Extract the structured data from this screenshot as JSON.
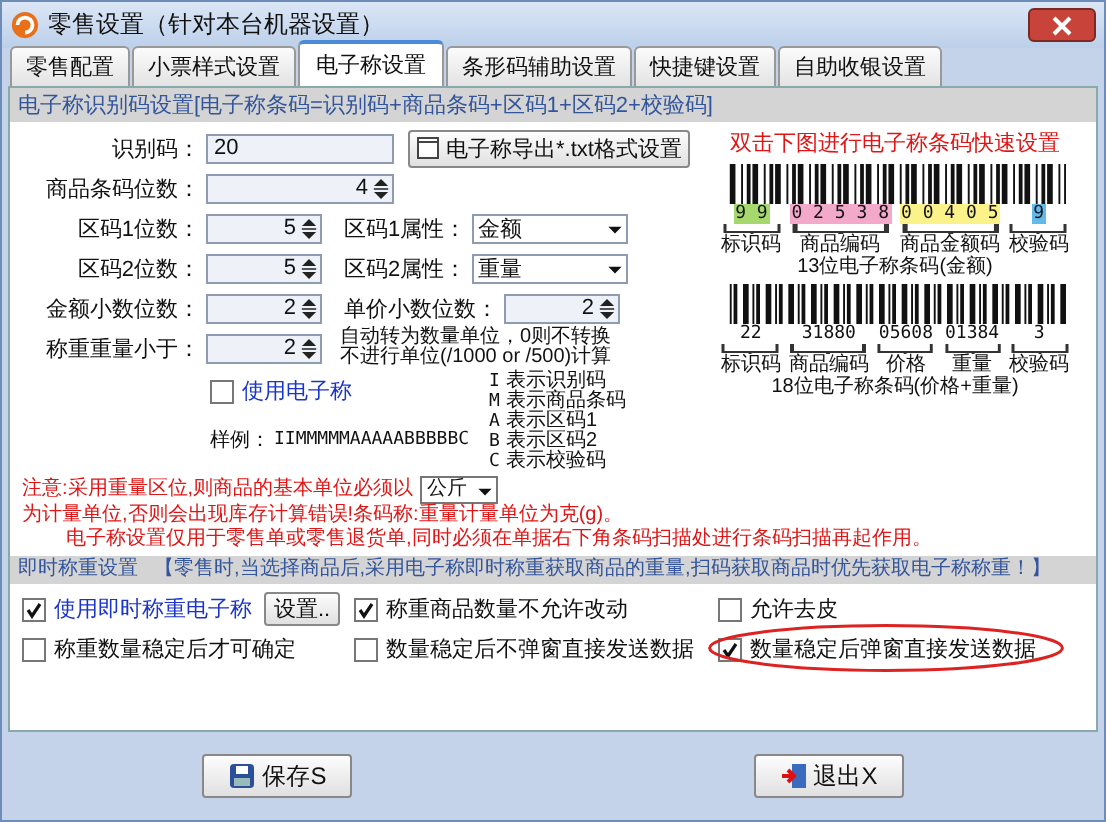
{
  "window": {
    "title": "零售设置（针对本台机器设置）"
  },
  "tabs": [
    {
      "label": "零售配置",
      "selected": false
    },
    {
      "label": "小票样式设置",
      "selected": false
    },
    {
      "label": "电子称设置",
      "selected": true
    },
    {
      "label": "条形码辅助设置",
      "selected": false
    },
    {
      "label": "快捷键设置",
      "selected": false
    },
    {
      "label": "自助收银设置",
      "selected": false
    }
  ],
  "barcode_settings": {
    "header": "电子称识别码设置[电子称条码=识别码+商品条码+区码1+区码2+校验码]",
    "rows": [
      {
        "items": [
          {
            "kind": "text",
            "label": "识别码：",
            "value": "20"
          },
          {
            "kind": "button",
            "label": "电子称导出*.txt格式设置"
          }
        ]
      },
      {
        "items": [
          {
            "kind": "spin",
            "label": "商品条码位数：",
            "value": "4"
          }
        ]
      },
      {
        "items": [
          {
            "kind": "spin",
            "label": "区码1位数：",
            "value": "5"
          },
          {
            "kind": "select",
            "label": "区码1属性：",
            "value": "金额"
          }
        ]
      },
      {
        "items": [
          {
            "kind": "spin",
            "label": "区码2位数：",
            "value": "5"
          },
          {
            "kind": "select",
            "label": "区码2属性：",
            "value": "重量"
          }
        ]
      },
      {
        "items": [
          {
            "kind": "spin",
            "label": "金额小数位数：",
            "value": "2"
          },
          {
            "kind": "spin",
            "label": "单价小数位数：",
            "value": "2"
          }
        ]
      },
      {
        "items": [
          {
            "kind": "spin",
            "label": "称重重量小于：",
            "value": "2"
          },
          {
            "kind": "hint",
            "lines": [
              "自动转为数量单位，0则不转换",
              "不进行单位(/1000 or /500)计算"
            ]
          }
        ]
      }
    ],
    "use_scale": {
      "label": "使用电子称",
      "checked": false
    },
    "sample": {
      "label": "样例：",
      "value": "IIMMMMMAAAAABBBBBC"
    },
    "legend": [
      {
        "key": "I",
        "text": "表示识别码"
      },
      {
        "key": "M",
        "text": "表示商品条码"
      },
      {
        "key": "A",
        "text": "表示区码1"
      },
      {
        "key": "B",
        "text": "表示区码2"
      },
      {
        "key": "C",
        "text": "表示校验码"
      }
    ],
    "quick_hint": "双击下图进行电子称条码快速设置",
    "barcodes": [
      {
        "caption": "13位电子称条码(金额)",
        "groups": [
          {
            "digits": "9 9",
            "label": "标识码",
            "color": "#a6d86e"
          },
          {
            "digits": "0 2 5 3 8",
            "label": "商品编码",
            "color": "#f3a9c9"
          },
          {
            "digits": "0 0 4 0 5",
            "label": "商品金额码",
            "color": "#fbf28a"
          },
          {
            "digits": "9",
            "label": "校验码",
            "color": "#62b9ea"
          }
        ]
      },
      {
        "caption": "18位电子称条码(价格+重量)",
        "groups": [
          {
            "digits": "22",
            "label": "标识码"
          },
          {
            "digits": "31880",
            "label": "商品编码"
          },
          {
            "digits": "05608",
            "label": "价格"
          },
          {
            "digits": "01384",
            "label": "重量"
          },
          {
            "digits": "3",
            "label": "校验码"
          }
        ]
      }
    ],
    "notes": {
      "before": "注意:采用重量区位,则商品的基本单位必须以",
      "unit": "公斤",
      "after": "为计量单位,否则会出现库存计算错误!条码称:重量计量单位为克(g)。",
      "line2": "电子称设置仅用于零售单或零售退货单,同时必须在单据右下角条码扫描处进行条码扫描再起作用。"
    }
  },
  "instant": {
    "title": "即时称重设置",
    "note": "【零售时,当选择商品后,采用电子称即时称重获取商品的重量,扫码获取商品时优先获取电子称称重！】",
    "settings_button": "设置..",
    "options": [
      {
        "label": "使用即时称重电子称",
        "checked": true,
        "circled": false
      },
      {
        "label": "称重商品数量不允许改动",
        "checked": true,
        "circled": false
      },
      {
        "label": "允许去皮",
        "checked": false,
        "circled": false
      },
      {
        "label": "称重数量稳定后才可确定",
        "checked": false,
        "circled": false
      },
      {
        "label": "数量稳定后不弹窗直接发送数据",
        "checked": false,
        "circled": false
      },
      {
        "label": "数量稳定后弹窗直接发送数据",
        "checked": true,
        "circled": true
      }
    ]
  },
  "buttons": [
    {
      "kind": "save",
      "label": "保存S"
    },
    {
      "kind": "exit",
      "label": "退出X"
    }
  ]
}
